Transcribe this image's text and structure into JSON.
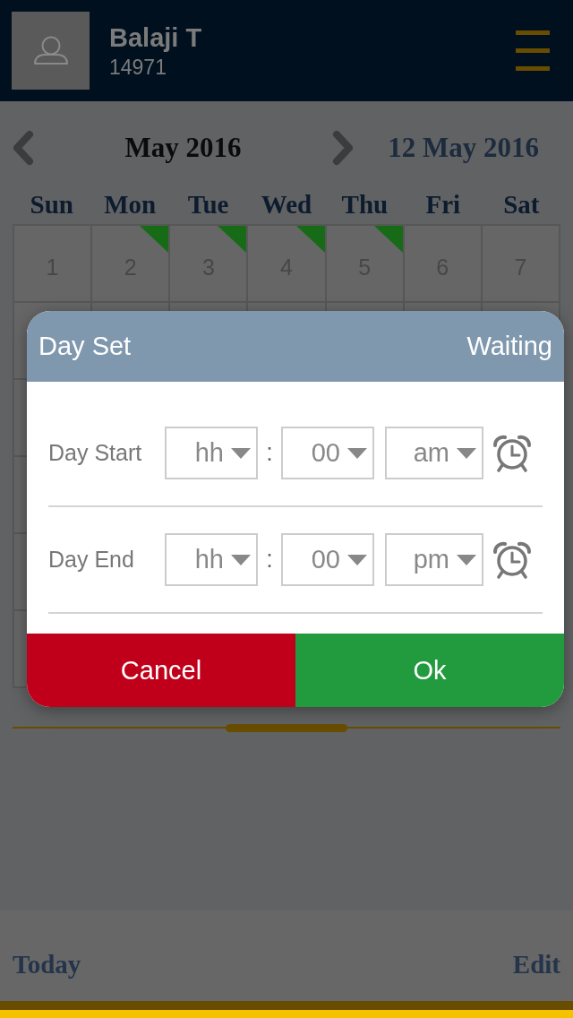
{
  "header": {
    "name": "Balaji T",
    "employee_id": "14971"
  },
  "calendar": {
    "month": "May 2016",
    "selected_date": "12 May 2016",
    "weekdays": [
      "Sun",
      "Mon",
      "Tue",
      "Wed",
      "Thu",
      "Fri",
      "Sat"
    ],
    "weeks": [
      [
        {
          "day": "1",
          "marked": false
        },
        {
          "day": "2",
          "marked": true
        },
        {
          "day": "3",
          "marked": true
        },
        {
          "day": "4",
          "marked": true
        },
        {
          "day": "5",
          "marked": true
        },
        {
          "day": "6",
          "marked": false
        },
        {
          "day": "7",
          "marked": false
        }
      ]
    ]
  },
  "dialog": {
    "title": "Day Set",
    "status": "Waiting",
    "rows": [
      {
        "label": "Day Start",
        "hour": "hh",
        "separator": ":",
        "minute": "00",
        "period": "am"
      },
      {
        "label": "Day End",
        "hour": "hh",
        "separator": ":",
        "minute": "00",
        "period": "pm"
      }
    ],
    "buttons": [
      {
        "label": "Cancel",
        "kind": "cancel"
      },
      {
        "label": "Ok",
        "kind": "confirm"
      }
    ]
  },
  "footer": {
    "today_button": "Today",
    "edit_button": "Edit"
  }
}
